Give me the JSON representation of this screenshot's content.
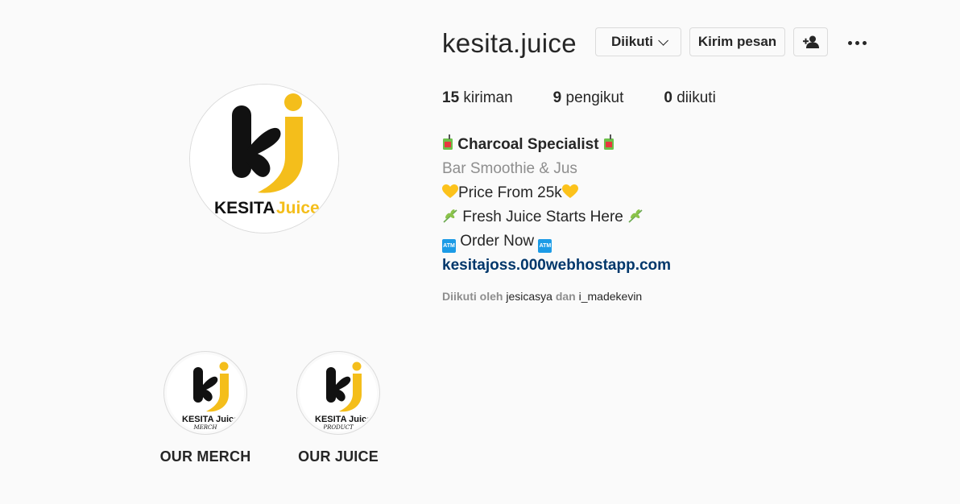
{
  "profile": {
    "username": "kesita.juice",
    "logo_text": "KESITA Juice"
  },
  "buttons": {
    "following_label": "Diikuti",
    "message_label": "Kirim pesan"
  },
  "stats": {
    "posts_count": "15",
    "posts_label": "kiriman",
    "followers_count": "9",
    "followers_label": "pengikut",
    "following_count": "0",
    "following_label": "diikuti"
  },
  "bio": {
    "title": "Charcoal Specialist",
    "category": "Bar Smoothie & Jus",
    "line1": "Price From 25k",
    "line2": "Fresh Juice Starts Here",
    "line3": "Order Now",
    "link": "kesitajoss.000webhostapp.com"
  },
  "followed_by": {
    "prefix": "Diikuti oleh",
    "user1": "jesicasya",
    "conj": "dan",
    "user2": "i_madekevin"
  },
  "highlights": [
    {
      "label": "OUR MERCH",
      "logo_text": "KESITA Juice",
      "sub": "MERCH"
    },
    {
      "label": "OUR JUICE",
      "logo_text": "KESITA Juice",
      "sub": "PRODUCT"
    }
  ],
  "colors": {
    "brand_yellow": "#f4be1b",
    "link": "#00376b",
    "muted": "#8e8e8e"
  },
  "icons": [
    "chevron-down-icon",
    "add-user-icon",
    "more-icon",
    "juice-box-icon",
    "yellow-heart-icon",
    "herb-icon",
    "atm-icon"
  ]
}
